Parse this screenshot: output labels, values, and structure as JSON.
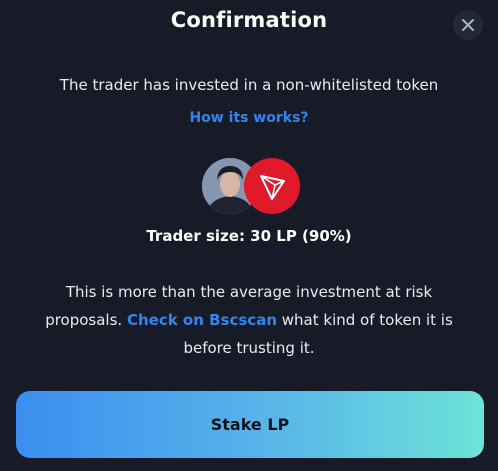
{
  "modal": {
    "title": "Confirmation",
    "subtitle": "The trader has invested in a non-whitelisted token",
    "help_link": "How its works?",
    "trader_size": "Trader size: 30 LP (90%)",
    "description": {
      "part1": "This is more than the average investment at risk proposals.",
      "link": "Check on Bscscan",
      "part2": "what kind of token it is before trusting it."
    },
    "stake_button": "Stake LP"
  },
  "colors": {
    "background": "#171b27",
    "link": "#2f86ee",
    "token_red": "#e0192b",
    "button_gradient_start": "#3a8ef0",
    "button_gradient_end": "#6ce3d8"
  },
  "icons": {
    "close": "close-icon",
    "token": "tron-token-icon",
    "avatar": "trader-avatar"
  }
}
